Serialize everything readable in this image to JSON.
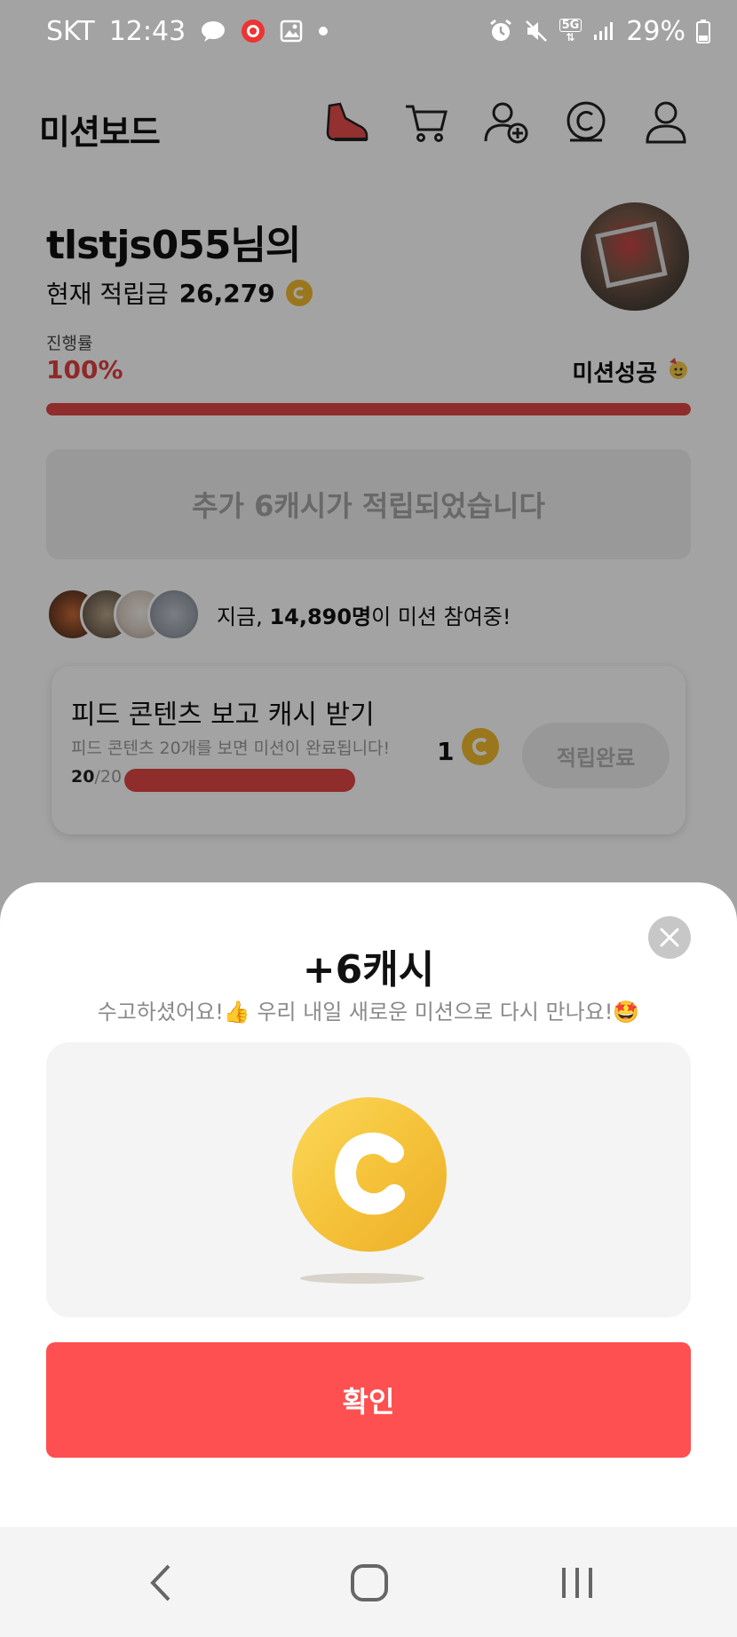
{
  "status_bar": {
    "carrier": "SKT",
    "time": "12:43",
    "network": "5G",
    "battery": "29%"
  },
  "header": {
    "title": "미션보드",
    "icons": [
      "shoe-icon",
      "cart-icon",
      "add-friend-icon",
      "cash-icon",
      "profile-icon"
    ]
  },
  "profile": {
    "username": "tlstjs055님의",
    "balance_label": "현재 적립금",
    "balance_value": "26,279"
  },
  "progress": {
    "label": "진행률",
    "percent_text": "100%",
    "fraction": 1.0,
    "status": "미션성공"
  },
  "banner": {
    "text": "추가 6캐시가 적립되었습니다"
  },
  "participants": {
    "prefix": "지금,",
    "count": "14,890명",
    "suffix": "이 미션 참여중!"
  },
  "mission_card": {
    "title": "피드 콘텐츠 보고 캐시 받기",
    "subtitle": "피드 콘텐츠 20개를 보면 미션이 완료됩니다!",
    "progress_done": "20",
    "progress_total": "/20",
    "reward": "1",
    "button_label": "적립완료"
  },
  "sheet": {
    "title": "+6캐시",
    "subtitle": "수고하셨어요!👍 우리 내일 새로운 미션으로 다시 만나요!🤩",
    "confirm_label": "확인"
  },
  "colors": {
    "accent": "#fe5050",
    "progress": "#e04545",
    "coin": "#f1b92e"
  }
}
